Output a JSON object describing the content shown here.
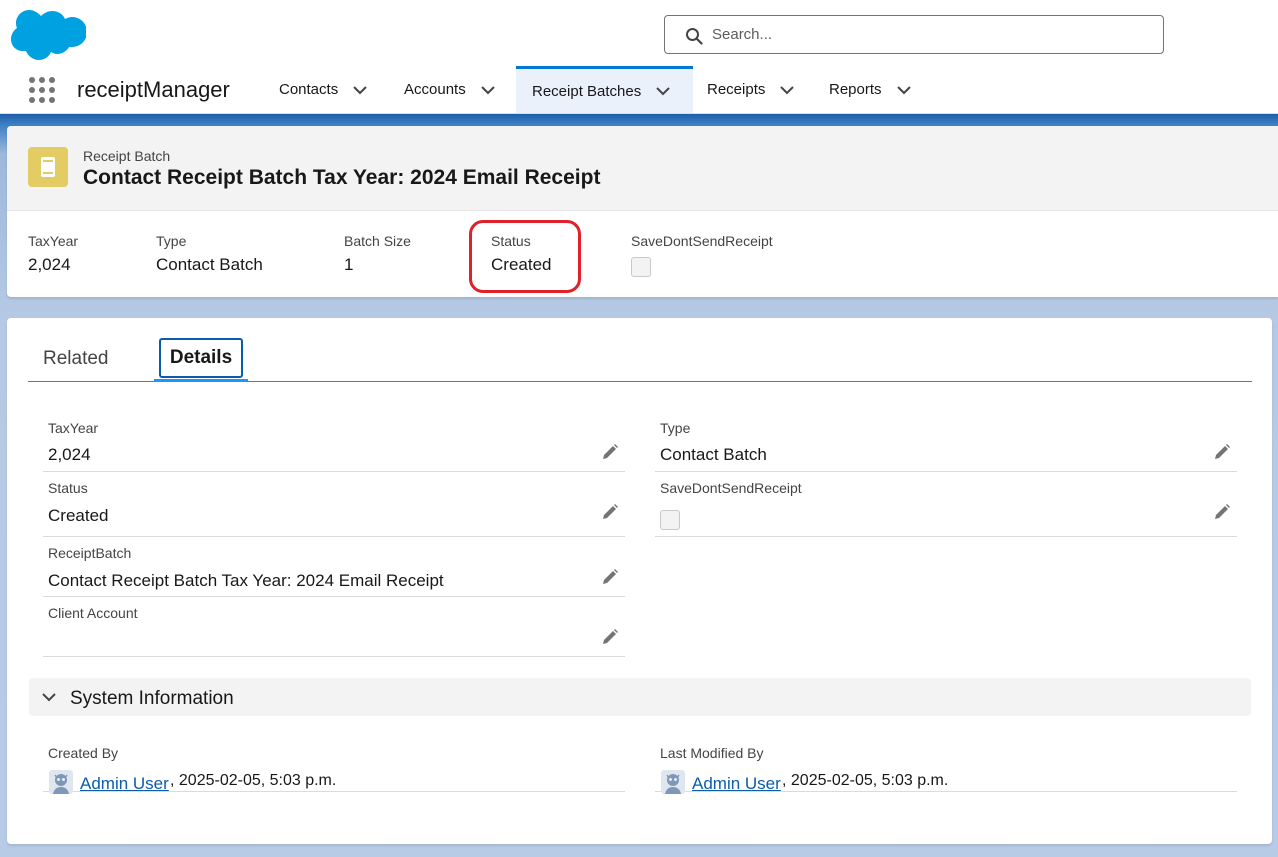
{
  "header": {
    "search_placeholder": "Search..."
  },
  "nav": {
    "app_name": "receiptManager",
    "tabs": [
      {
        "label": "Contacts"
      },
      {
        "label": "Accounts"
      },
      {
        "label": "Receipt Batches",
        "active": true
      },
      {
        "label": "Receipts"
      },
      {
        "label": "Reports"
      }
    ]
  },
  "record": {
    "object_label": "Receipt Batch",
    "title": "Contact Receipt Batch Tax Year: 2024 Email Receipt",
    "highlights": [
      {
        "label": "TaxYear",
        "value": "2,024"
      },
      {
        "label": "Type",
        "value": "Contact Batch"
      },
      {
        "label": "Batch Size",
        "value": "1"
      },
      {
        "label": "Status",
        "value": "Created"
      },
      {
        "label": "SaveDontSendReceipt",
        "checked": false
      }
    ]
  },
  "tabs": {
    "related": "Related",
    "details": "Details"
  },
  "details": {
    "taxyear_label": "TaxYear",
    "taxyear_value": "2,024",
    "type_label": "Type",
    "type_value": "Contact Batch",
    "status_label": "Status",
    "status_value": "Created",
    "savedontsend_label": "SaveDontSendReceipt",
    "savedontsend_checked": false,
    "receiptbatch_label": "ReceiptBatch",
    "receiptbatch_value": "Contact Receipt Batch Tax Year: 2024 Email Receipt",
    "client_account_label": "Client Account",
    "client_account_value": ""
  },
  "system_info": {
    "title": "System Information",
    "created_by_label": "Created By",
    "created_by_user": "Admin User",
    "created_by_date": ", 2025-02-05, 5:03 p.m.",
    "modified_by_label": "Last Modified By",
    "modified_by_user": "Admin User",
    "modified_by_date": ", 2025-02-05, 5:03 p.m."
  },
  "colors": {
    "brand": "#00a1e0",
    "accent": "#0176d3",
    "object_icon": "#e3cc63",
    "highlight_border": "#e0202a",
    "link": "#0b5cab"
  },
  "icons": [
    "salesforce-cloud-logo",
    "search-icon",
    "app-launcher-icon",
    "chevron-down-icon",
    "receipt-batch-icon",
    "edit-pencil-icon",
    "avatar-icon"
  ]
}
